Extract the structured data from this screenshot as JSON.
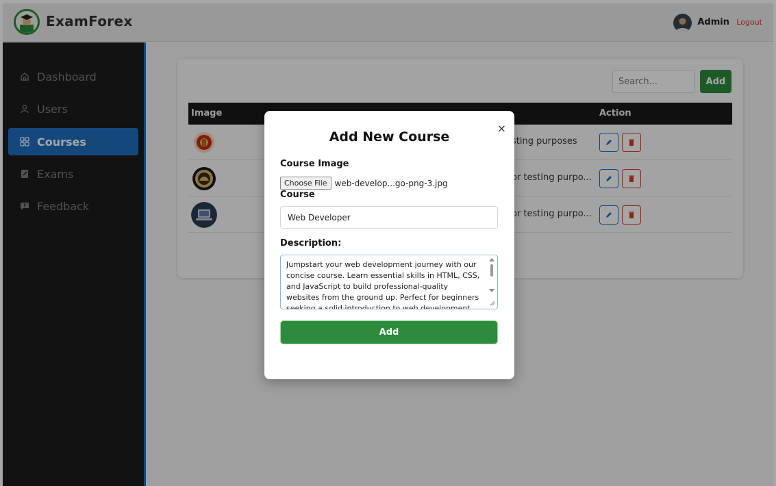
{
  "header": {
    "brand": "ExamForex",
    "admin_name": "Admin",
    "logout_label": "Logout"
  },
  "sidebar": {
    "items": [
      {
        "label": "Dashboard",
        "icon": "home-icon"
      },
      {
        "label": "Users",
        "icon": "user-icon"
      },
      {
        "label": "Courses",
        "icon": "grid-icon",
        "active": true
      },
      {
        "label": "Exams",
        "icon": "exam-icon"
      },
      {
        "label": "Feedback",
        "icon": "feedback-icon"
      }
    ]
  },
  "toolbar": {
    "search_placeholder": "Search...",
    "add_label": "Add"
  },
  "table": {
    "headers": [
      "Image",
      "Action"
    ],
    "rows": [
      {
        "description": "sting purposes",
        "image": "emblem-logo"
      },
      {
        "description": "or testing purpo...",
        "image": "rbi-logo"
      },
      {
        "description": "or testing purpo...",
        "image": "laptop-logo"
      }
    ]
  },
  "modal": {
    "title": "Add New Course",
    "close_symbol": "×",
    "image_label": "Course Image",
    "file_button": "Choose File",
    "file_name": "web-develop...go-png-3.jpg",
    "course_label": "Course",
    "course_value": "Web Developer",
    "description_label": "Description:",
    "description_value": "Jumpstart your web development journey with our concise course. Learn essential skills in HTML, CSS, and JavaScript to build professional-quality websites from the ground up. Perfect for beginners seeking a solid introduction to web development.",
    "submit_label": "Add"
  },
  "colors": {
    "accent_blue": "#1f6fc0",
    "success_green": "#2e8b3c",
    "danger_red": "#d23a2a",
    "sidebar_bg": "#1c1c1c"
  }
}
